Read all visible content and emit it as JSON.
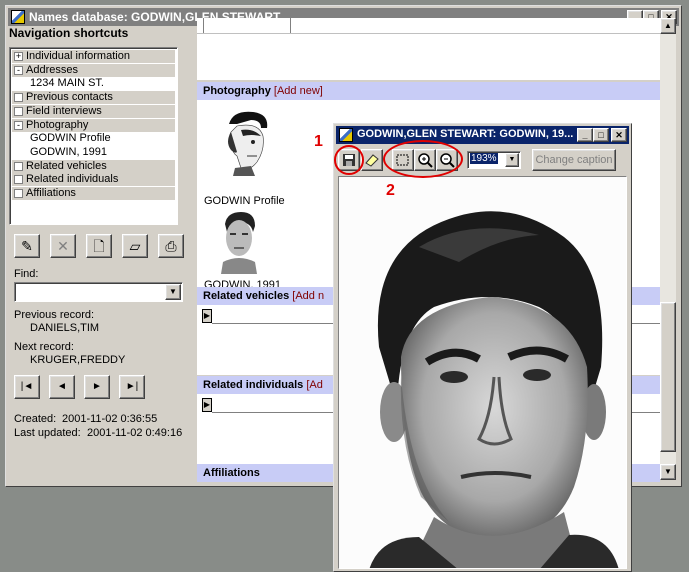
{
  "main_window": {
    "title": "Names database: GODWIN,GLEN STEWART"
  },
  "nav": {
    "heading": "Navigation shortcuts",
    "items": [
      {
        "label": "Individual information",
        "kind": "header",
        "expander": "+"
      },
      {
        "label": "Addresses",
        "kind": "header",
        "expander": "-"
      },
      {
        "label": "1234 MAIN ST.",
        "kind": "sub"
      },
      {
        "label": "Previous contacts",
        "kind": "header",
        "expander": ""
      },
      {
        "label": "Field interviews",
        "kind": "header",
        "expander": ""
      },
      {
        "label": "Photography",
        "kind": "header",
        "expander": "-"
      },
      {
        "label": "GODWIN Profile",
        "kind": "sub"
      },
      {
        "label": "GODWIN, 1991",
        "kind": "sub"
      },
      {
        "label": "Related vehicles",
        "kind": "header",
        "expander": ""
      },
      {
        "label": "Related individuals",
        "kind": "header",
        "expander": ""
      },
      {
        "label": "Affiliations",
        "kind": "header",
        "expander": ""
      }
    ]
  },
  "toolbar": {
    "buttons": [
      {
        "name": "edit-button",
        "icon": "pencil-icon",
        "glyph": "✎"
      },
      {
        "name": "delete-button",
        "icon": "x-icon",
        "glyph": "✕"
      },
      {
        "name": "new-button",
        "icon": "document-icon",
        "glyph": "🗋"
      },
      {
        "name": "erase-button",
        "icon": "eraser-icon",
        "glyph": "▱"
      },
      {
        "name": "print-button",
        "icon": "printer-icon",
        "glyph": "⎙"
      }
    ]
  },
  "find": {
    "label": "Find:",
    "value": ""
  },
  "records": {
    "previous_label": "Previous record:",
    "previous_value": "DANIELS,TIM",
    "next_label": "Next record:",
    "next_value": "KRUGER,FREDDY",
    "created_label": "Created:",
    "created_value": "2001-11-02 0:36:55",
    "updated_label": "Last updated:",
    "updated_value": "2001-11-02 0:49:16"
  },
  "nav_buttons": [
    "|◄",
    "◄",
    "►",
    "►|"
  ],
  "sections": {
    "photography": {
      "title": "Photography",
      "link": "[Add new]"
    },
    "photos": [
      {
        "caption": "GODWIN Profile"
      },
      {
        "caption": "GODWIN, 1991"
      }
    ],
    "vehicles": {
      "title": "Related vehicles",
      "link": "[Add n"
    },
    "individuals": {
      "title": "Related individuals",
      "link": "[Ad"
    },
    "affiliations": {
      "title": "Affiliations"
    }
  },
  "image_window": {
    "title": "GODWIN,GLEN STEWART: GODWIN, 19...",
    "zoom": "193%",
    "change_caption": "Change caption"
  },
  "annotations": {
    "one": "1",
    "two": "2"
  },
  "colors": {
    "section_bg": "#c8ccf6",
    "annotation": "#e00000",
    "link": "#800000"
  }
}
